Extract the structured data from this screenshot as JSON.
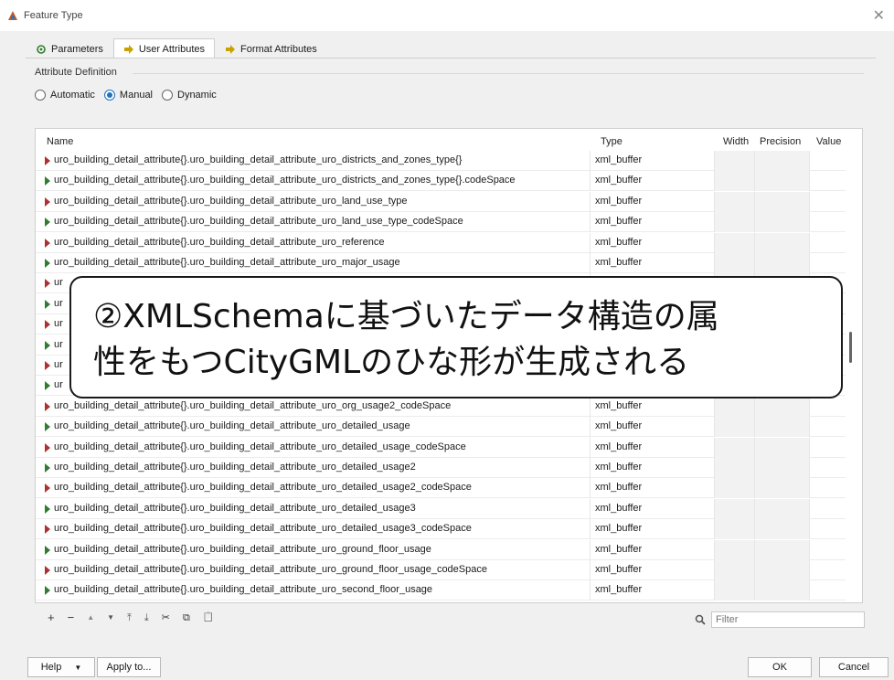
{
  "window": {
    "title": "Feature Type",
    "close_glyph": "✕"
  },
  "tabs": [
    {
      "label": "Parameters",
      "icon": "gear-icon"
    },
    {
      "label": "User Attributes",
      "icon": "arrow-right-icon"
    },
    {
      "label": "Format Attributes",
      "icon": "arrow-right-icon"
    }
  ],
  "attribute_definition": {
    "label": "Attribute Definition",
    "options": [
      "Automatic",
      "Manual",
      "Dynamic"
    ],
    "selected": "Manual"
  },
  "table": {
    "headers": {
      "name": "Name",
      "type": "Type",
      "width": "Width",
      "precision": "Precision",
      "value": "Value"
    },
    "rows": [
      {
        "name": "uro_building_detail_attribute{}.uro_building_detail_attribute_uro_districts_and_zones_type{}",
        "type": "xml_buffer"
      },
      {
        "name": "uro_building_detail_attribute{}.uro_building_detail_attribute_uro_districts_and_zones_type{}.codeSpace",
        "type": "xml_buffer"
      },
      {
        "name": "uro_building_detail_attribute{}.uro_building_detail_attribute_uro_land_use_type",
        "type": "xml_buffer"
      },
      {
        "name": "uro_building_detail_attribute{}.uro_building_detail_attribute_uro_land_use_type_codeSpace",
        "type": "xml_buffer"
      },
      {
        "name": "uro_building_detail_attribute{}.uro_building_detail_attribute_uro_reference",
        "type": "xml_buffer"
      },
      {
        "name": "uro_building_detail_attribute{}.uro_building_detail_attribute_uro_major_usage",
        "type": "xml_buffer"
      },
      {
        "name": "ur",
        "type": ""
      },
      {
        "name": "ur",
        "type": ""
      },
      {
        "name": "ur",
        "type": ""
      },
      {
        "name": "ur",
        "type": ""
      },
      {
        "name": "ur",
        "type": ""
      },
      {
        "name": "ur",
        "type": ""
      },
      {
        "name": "uro_building_detail_attribute{}.uro_building_detail_attribute_uro_org_usage2_codeSpace",
        "type": "xml_buffer"
      },
      {
        "name": "uro_building_detail_attribute{}.uro_building_detail_attribute_uro_detailed_usage",
        "type": "xml_buffer"
      },
      {
        "name": "uro_building_detail_attribute{}.uro_building_detail_attribute_uro_detailed_usage_codeSpace",
        "type": "xml_buffer"
      },
      {
        "name": "uro_building_detail_attribute{}.uro_building_detail_attribute_uro_detailed_usage2",
        "type": "xml_buffer"
      },
      {
        "name": "uro_building_detail_attribute{}.uro_building_detail_attribute_uro_detailed_usage2_codeSpace",
        "type": "xml_buffer"
      },
      {
        "name": "uro_building_detail_attribute{}.uro_building_detail_attribute_uro_detailed_usage3",
        "type": "xml_buffer"
      },
      {
        "name": "uro_building_detail_attribute{}.uro_building_detail_attribute_uro_detailed_usage3_codeSpace",
        "type": "xml_buffer"
      },
      {
        "name": "uro_building_detail_attribute{}.uro_building_detail_attribute_uro_ground_floor_usage",
        "type": "xml_buffer"
      },
      {
        "name": "uro_building_detail_attribute{}.uro_building_detail_attribute_uro_ground_floor_usage_codeSpace",
        "type": "xml_buffer"
      },
      {
        "name": "uro_building_detail_attribute{}.uro_building_detail_attribute_uro_second_floor_usage",
        "type": "xml_buffer"
      }
    ]
  },
  "toolbar": {
    "add": "+",
    "remove": "−",
    "move_up": "▲",
    "move_down": "▼",
    "move_top": "⤒",
    "move_bottom": "⤓",
    "cut": "✂",
    "copy": "⧉",
    "paste": "📋"
  },
  "filter": {
    "placeholder": "Filter"
  },
  "buttons": {
    "help": "Help",
    "apply_to": "Apply to...",
    "ok": "OK",
    "cancel": "Cancel"
  },
  "callout": {
    "line1": "②XMLSchemaに基づいたデータ構造の属",
    "line2": "性をもつCityGMLのひな形が生成される"
  },
  "colors": {
    "accent": "#1e73be",
    "arrow_red": "#b03030",
    "arrow_green": "#2f7d2f"
  }
}
